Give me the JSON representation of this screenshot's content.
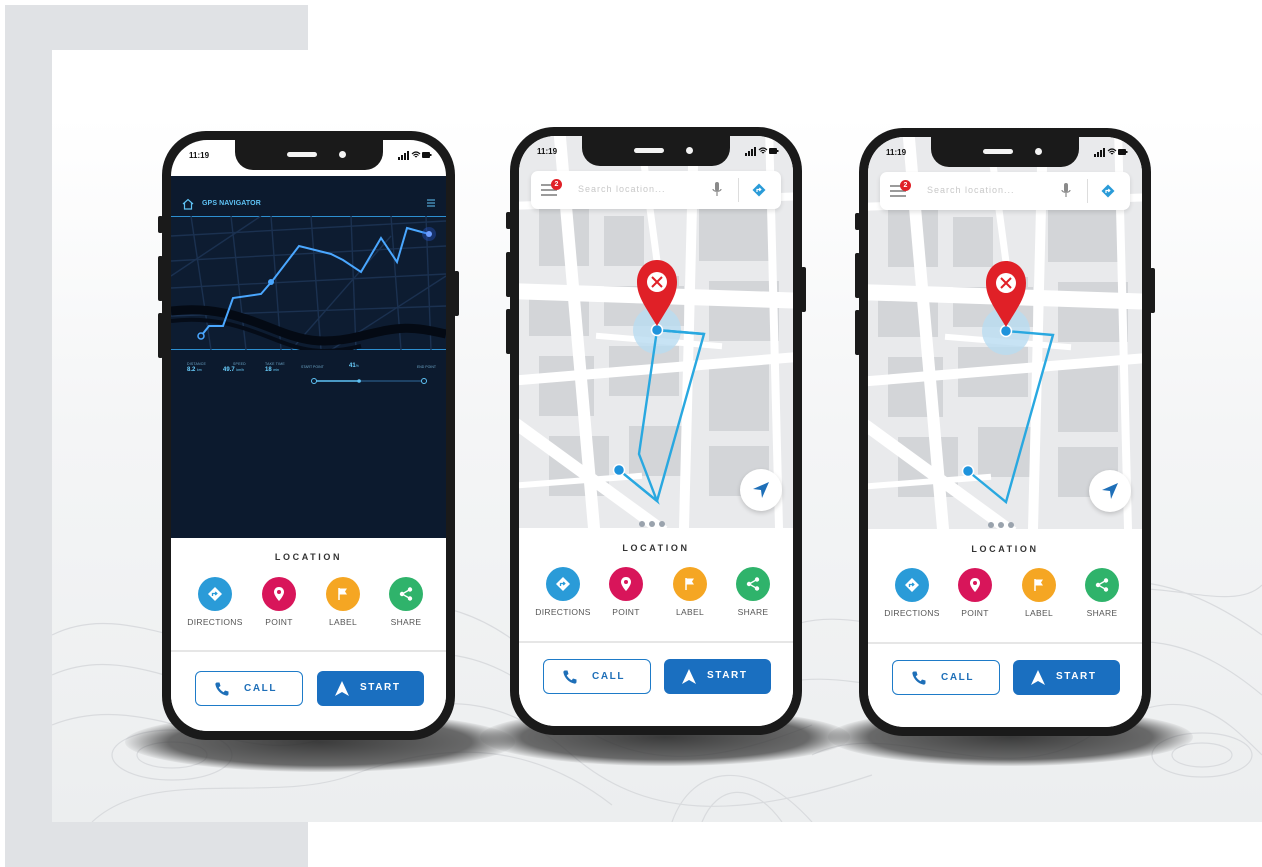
{
  "colors": {
    "directions": "#2a9bd8",
    "point": "#d8155a",
    "label": "#f5a623",
    "share": "#2fb36b",
    "start": "#1a6fc0",
    "route": "#29a8e0",
    "pin": "#e02027",
    "dark_bg": "#0c1a2e"
  },
  "phone1": {
    "time": "11:19",
    "title": "GPS NAVIGATOR",
    "stats": {
      "distance_label": "DISTANCE",
      "distance_value": "8.2",
      "distance_unit": "km",
      "speed_label": "SPEED",
      "speed_value": "49.7",
      "speed_unit": "km/h",
      "time_label": "TAKE TIME",
      "time_value": "18",
      "time_unit": "min",
      "start_label": "START POINT",
      "end_label": "END POINT",
      "progress_value": "41",
      "progress_unit": "%"
    },
    "progress_fraction": 0.41
  },
  "phone2": {
    "time": "11:19",
    "badge": "2",
    "search_placeholder": "Search location..."
  },
  "phone3": {
    "time": "11:19",
    "badge": "2",
    "search_placeholder": "Search location..."
  },
  "panel": {
    "location_title": "LOCATION",
    "actions": [
      {
        "label": "DIRECTIONS",
        "icon": "directions-icon"
      },
      {
        "label": "POINT",
        "icon": "location-pin-icon"
      },
      {
        "label": "LABEL",
        "icon": "flag-icon"
      },
      {
        "label": "SHARE",
        "icon": "share-icon"
      }
    ],
    "call_label": "CALL",
    "start_label": "START"
  }
}
